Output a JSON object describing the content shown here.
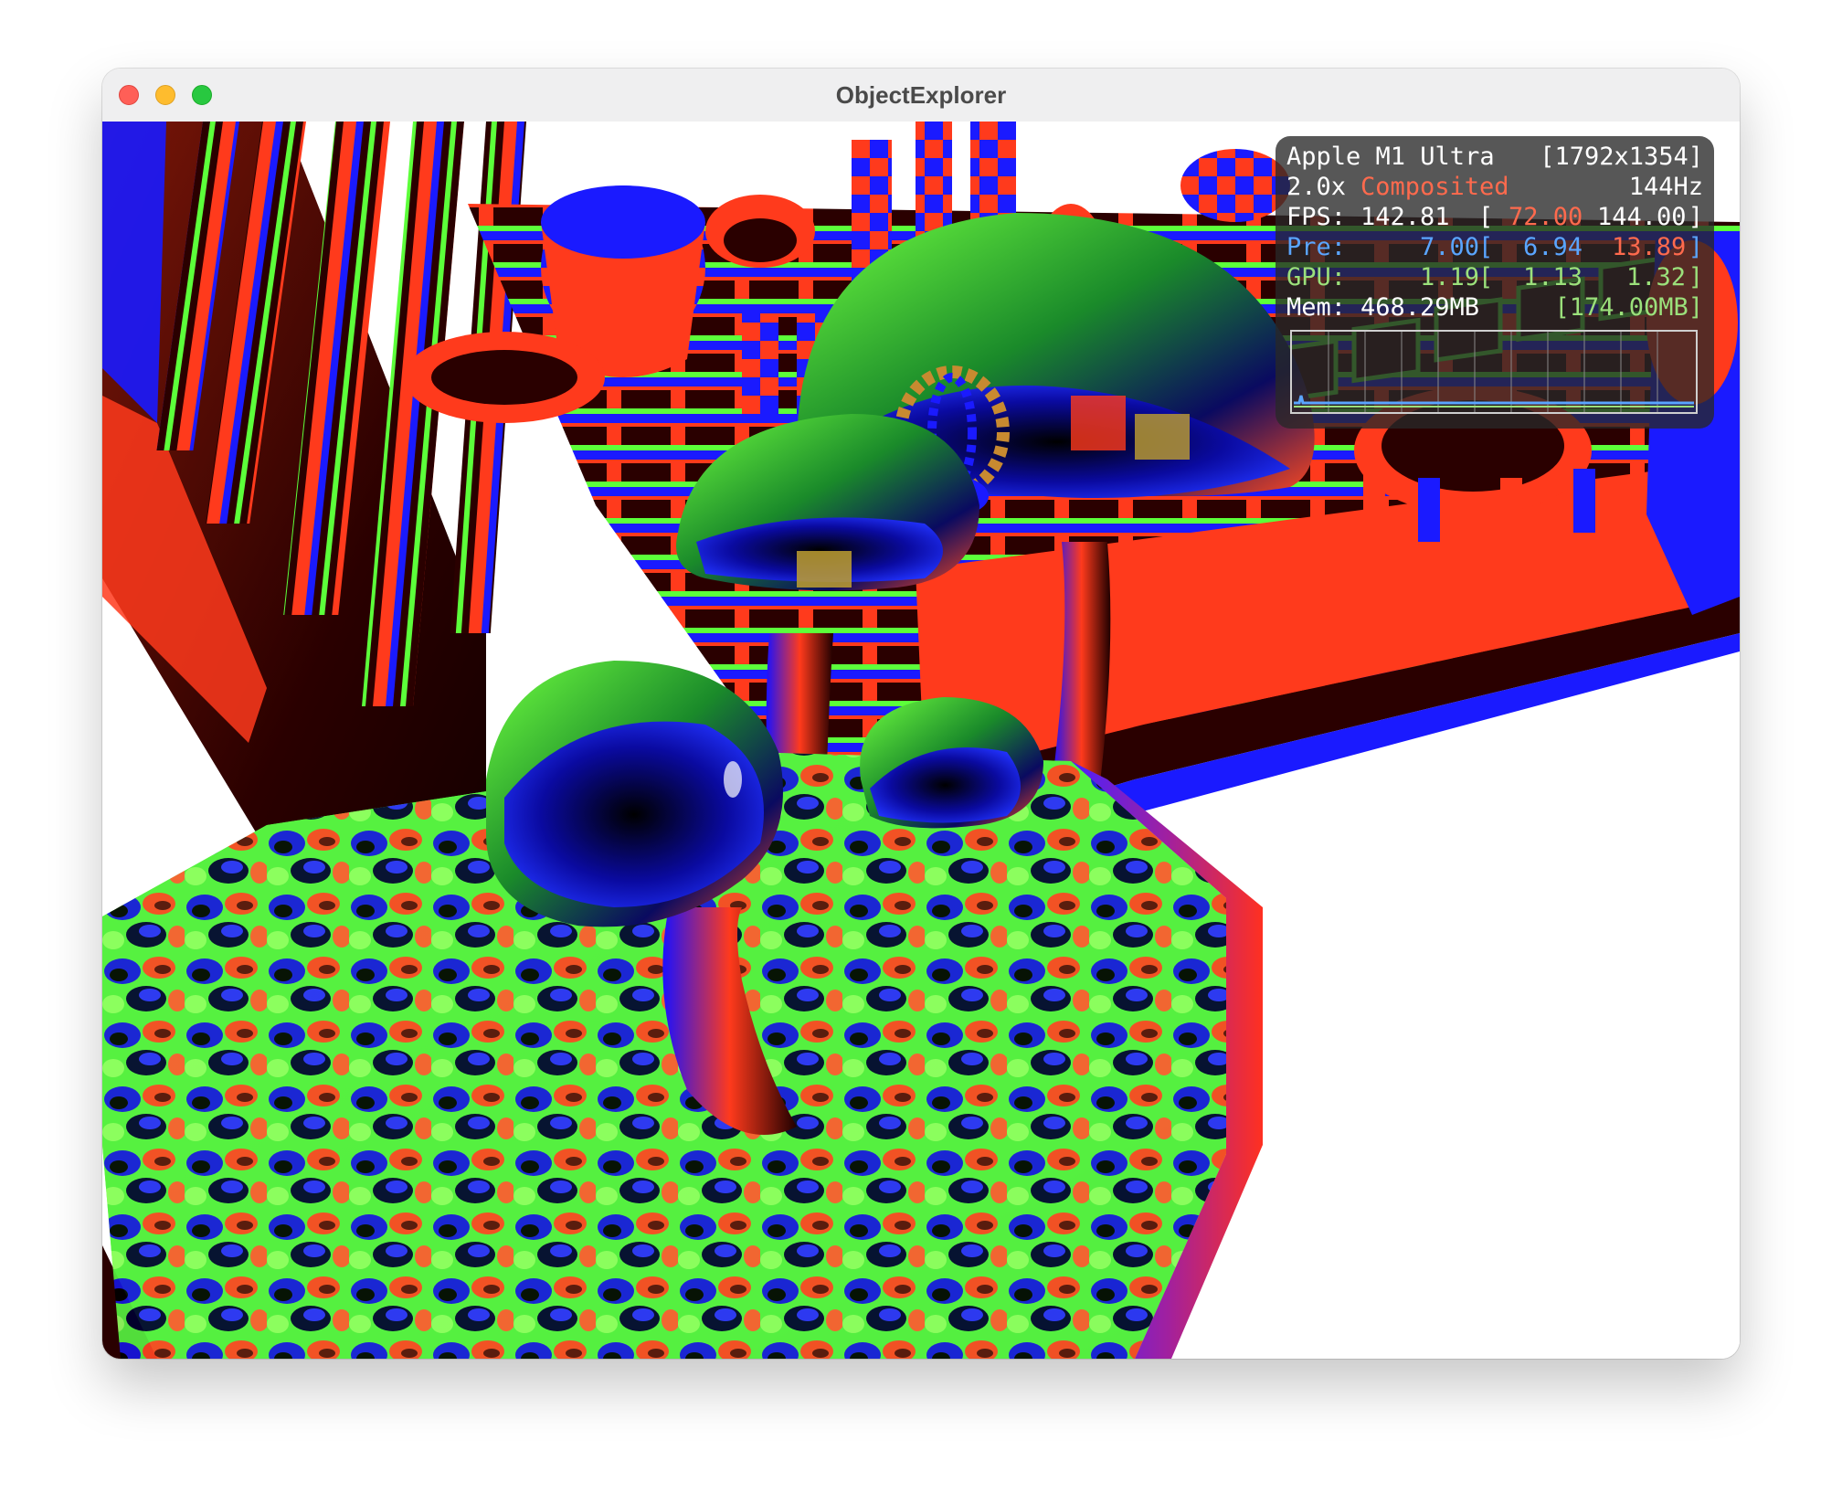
{
  "window": {
    "title": "ObjectExplorer"
  },
  "hud": {
    "device": "Apple M1 Ultra",
    "resolution": "[1792x1354]",
    "scale": "2.0x",
    "mode": "Composited",
    "refresh": "144Hz",
    "fps": {
      "label": "FPS:",
      "value": "142.81",
      "open": "[",
      "min": "72.00",
      "max": "144.00",
      "close": "]"
    },
    "pre": {
      "label": "Pre:",
      "value": "7.00",
      "open": "[",
      "min": "6.94",
      "max": "13.89",
      "close": "]"
    },
    "gpu": {
      "label": "GPU:",
      "value": "1.19",
      "open": "[",
      "min": "1.13",
      "max": "1.32",
      "close": "]"
    },
    "mem": {
      "label": "Mem:",
      "value": "468.29MB",
      "peak": "[174.00MB]"
    }
  },
  "colors": {
    "red": "#ff3a1c",
    "green": "#5cff3a",
    "blue": "#1a1aff",
    "dark": "#2a0000",
    "hud_red": "#ff6a4d",
    "hud_blue": "#5aa5ff",
    "hud_green": "#9be07b"
  }
}
